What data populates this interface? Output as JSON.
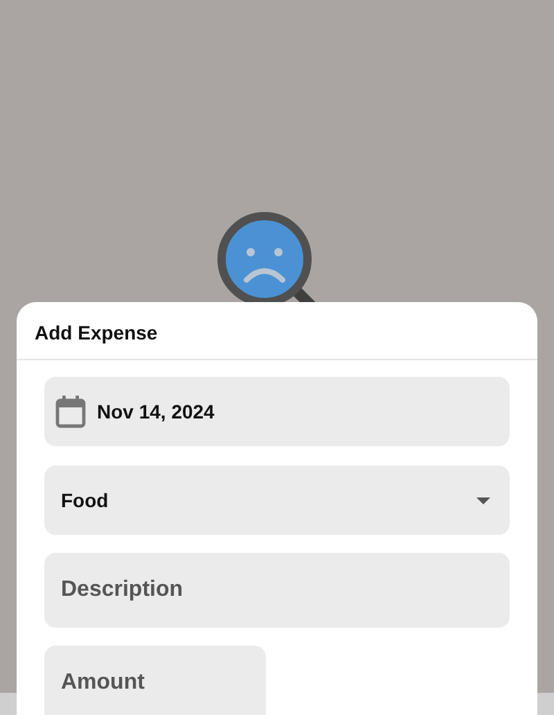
{
  "sheet": {
    "title": "Add Expense"
  },
  "fields": [
    {
      "kind": "date",
      "value": "Nov 14, 2024"
    },
    {
      "kind": "select",
      "value": "Food"
    },
    {
      "kind": "text",
      "placeholder": "Description"
    },
    {
      "kind": "amount",
      "placeholder": "Amount"
    }
  ]
}
